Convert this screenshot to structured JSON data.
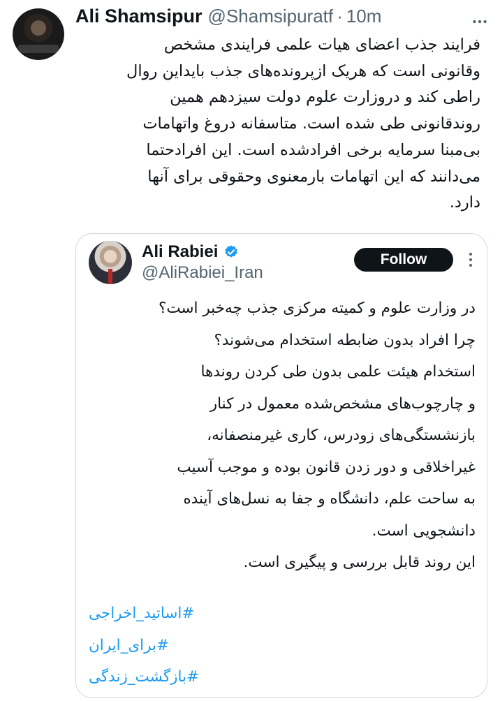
{
  "tweet": {
    "author": {
      "display_name": "Ali Shamsipur",
      "handle": "@Shamsipuratf"
    },
    "separator": "·",
    "time": "10m",
    "body_lines": [
      "فرایند جذب اعضای هیات علمی فرایندی مشخص",
      "وقانونی است که هریک ازپرونده‌های جذب بایداین روال",
      "راطی کند و دروزارت علوم دولت سیزدهم همین",
      "روندقانونی طی شده است. متاسفانه دروغ واتهامات",
      "بی‌مبنا سرمایه برخی افرادشده است. این افرادحتما",
      "می‌دانند که این اتهامات بارمعنوی وحقوقی برای آنها",
      "دارد."
    ],
    "more_icon": "more-horizontal-icon"
  },
  "quoted_tweet": {
    "author": {
      "display_name": "Ali Rabiei",
      "handle": "@AliRabiei_Iran",
      "verified_icon": "verified-badge-icon",
      "verified_color": "#1d9bf0"
    },
    "follow_label": "Follow",
    "more_icon": "more-vertical-icon",
    "body_lines": [
      "در وزارت علوم و کمیته مرکزی جذب چه‌خبر است؟",
      "چرا افراد بدون ضابطه استخدام می‌شوند؟",
      "استخدام هیئت علمی بدون طی کردن روندها",
      "و چارچوب‌های مشخص‌شده معمول در کنار",
      "بازنشستگی‌های زودرس، کاری غیرمنصفانه،",
      "غیراخلاقی و دور زدن قانون بوده و موجب آسیب",
      "به ساحت علم، دانشگاه و جفا به نسل‌های آینده",
      "دانشجویی است.",
      "این روند قابل بررسی و پیگیری است."
    ],
    "hashtags": [
      "#اساتید_اخراجی",
      "#برای_ایران",
      "#بازگشت_زندگی"
    ]
  },
  "colors": {
    "text_primary": "#0f1419",
    "text_secondary": "#536471",
    "link": "#1d9bf0",
    "border": "#cfd9de",
    "follow_button_bg": "#0f1419"
  }
}
